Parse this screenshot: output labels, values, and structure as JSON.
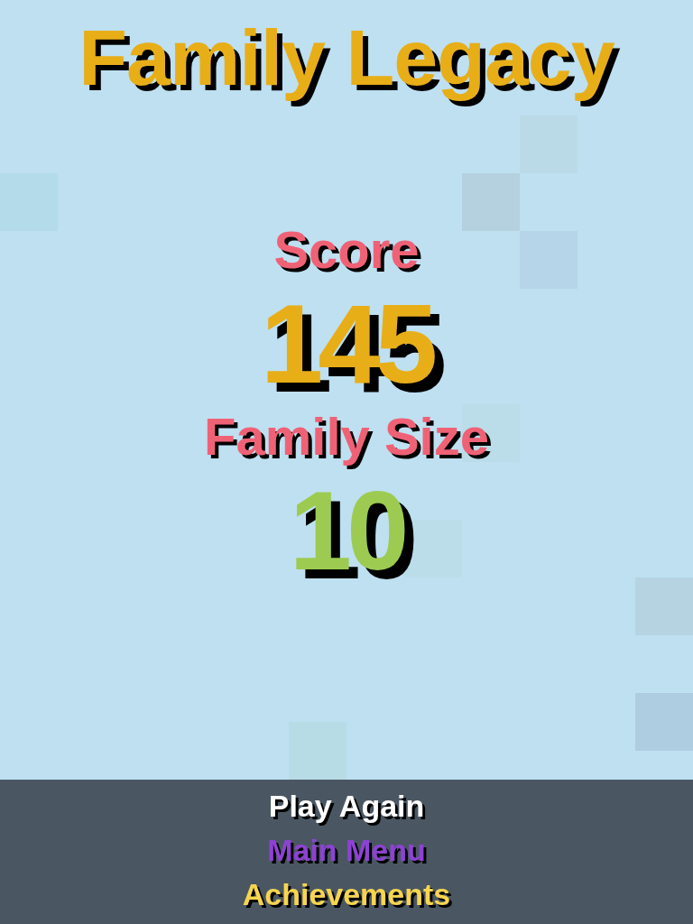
{
  "title": "Family Legacy",
  "stats": [
    {
      "label": "Score",
      "value": "145",
      "color": "#e8ae18"
    },
    {
      "label": "Family Size",
      "value": "10",
      "color": "#9dcb52"
    }
  ],
  "menu": [
    {
      "label": "Play Again",
      "color": "#ffffff"
    },
    {
      "label": "Main Menu",
      "color": "#8e42d3"
    },
    {
      "label": "Achievements",
      "color": "#f7d54e"
    }
  ]
}
